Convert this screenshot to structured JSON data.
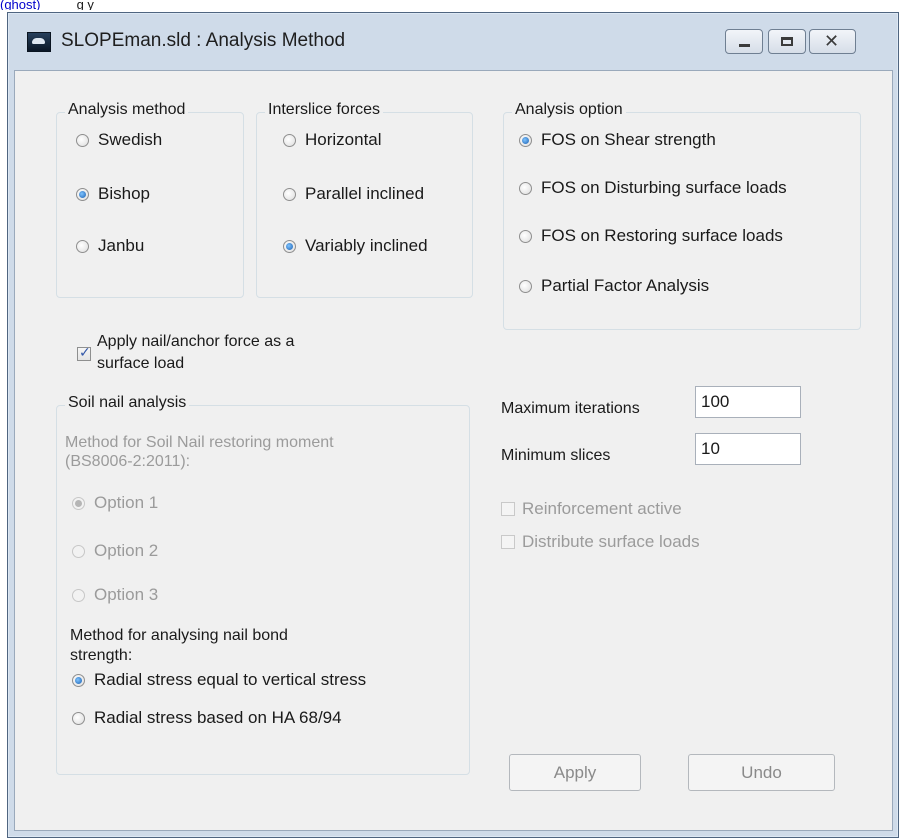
{
  "page_top_text": {
    "link": "(ghost)",
    "rest": "          g y"
  },
  "window": {
    "title": "SLOPEman.sld : Analysis Method",
    "controls": {
      "minimize": "minimize-icon",
      "maximize": "maximize-icon",
      "close_glyph": "✕"
    }
  },
  "analysis_method": {
    "legend": "Analysis method",
    "options": [
      {
        "label": "Swedish",
        "selected": false
      },
      {
        "label": "Bishop",
        "selected": true
      },
      {
        "label": "Janbu",
        "selected": false
      }
    ]
  },
  "interslice_forces": {
    "legend": "Interslice forces",
    "options": [
      {
        "label": "Horizontal",
        "selected": false
      },
      {
        "label": "Parallel inclined",
        "selected": false
      },
      {
        "label": "Variably inclined",
        "selected": true
      }
    ]
  },
  "analysis_option": {
    "legend": "Analysis option",
    "options": [
      {
        "label": "FOS on Shear strength",
        "selected": true
      },
      {
        "label": "FOS on Disturbing surface loads",
        "selected": false
      },
      {
        "label": "FOS on Restoring surface loads",
        "selected": false
      },
      {
        "label": "Partial Factor Analysis",
        "selected": false
      }
    ]
  },
  "apply_nail": {
    "line1": "Apply nail/anchor force as a",
    "line2": "surface load",
    "checked": true
  },
  "soil_nail": {
    "legend": "Soil nail analysis",
    "restoring_heading_1": "Method for Soil Nail restoring moment",
    "restoring_heading_2": "(BS8006-2:2011):",
    "restoring_options": [
      {
        "label": "Option 1",
        "selected": true,
        "disabled": true
      },
      {
        "label": "Option 2",
        "selected": false,
        "disabled": true
      },
      {
        "label": "Option 3",
        "selected": false,
        "disabled": true
      }
    ],
    "bond_heading_1": "Method for analysing nail bond",
    "bond_heading_2": "strength:",
    "bond_options": [
      {
        "label": "Radial stress equal to vertical stress",
        "selected": true
      },
      {
        "label": "Radial stress based on HA 68/94",
        "selected": false
      }
    ]
  },
  "settings": {
    "max_iterations_label": "Maximum iterations",
    "max_iterations_value": "100",
    "min_slices_label": "Minimum slices",
    "min_slices_value": "10",
    "reinforcement_label": "Reinforcement active",
    "distribute_label": "Distribute surface loads"
  },
  "buttons": {
    "apply": "Apply",
    "undo": "Undo"
  }
}
